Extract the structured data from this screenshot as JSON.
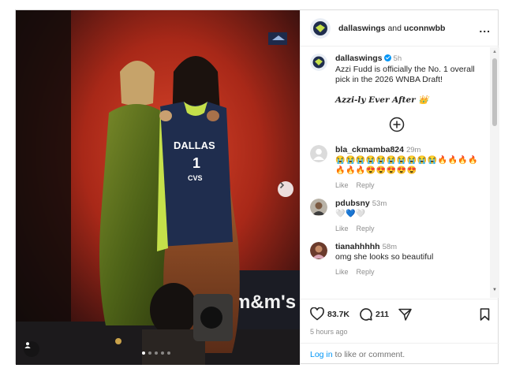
{
  "post": {
    "header_user": "dallaswings",
    "header_and": "and",
    "header_collab": "uconnwbb",
    "more_icon": "..."
  },
  "media": {
    "jersey_text": "DALLAS",
    "jersey_number": "1",
    "jersey_sponsor": "CVS",
    "banner_text": "m&m's",
    "page_count": 5,
    "active_page": 1
  },
  "caption": {
    "user": "dallaswings",
    "time": "5h",
    "text": "Azzi Fudd is officially the No. 1 overall pick in the 2026 WNBA Draft!",
    "tagline": "Azzi-ly Ever After 👑"
  },
  "comments": [
    {
      "user": "bla_ckmamba824",
      "time": "29m",
      "text": "😭😭😭😭😭😭😭😭😭😭🔥🔥🔥🔥🔥🔥🔥😍😍😍😍😍",
      "like": "Like",
      "reply": "Reply"
    },
    {
      "user": "pdubsny",
      "time": "53m",
      "text": "🤍💙🤍",
      "like": "Like",
      "reply": "Reply"
    },
    {
      "user": "tianahhhhh",
      "time": "58m",
      "text": "omg she looks so beautiful",
      "like": "Like",
      "reply": "Reply"
    }
  ],
  "actions": {
    "likes": "83.7K",
    "comments": "211",
    "ago": "5 hours ago"
  },
  "login": {
    "link": "Log in",
    "rest": "to like or comment."
  },
  "colors": {
    "accent": "#0095f6",
    "text": "#262626",
    "muted": "#8e8e8e"
  }
}
